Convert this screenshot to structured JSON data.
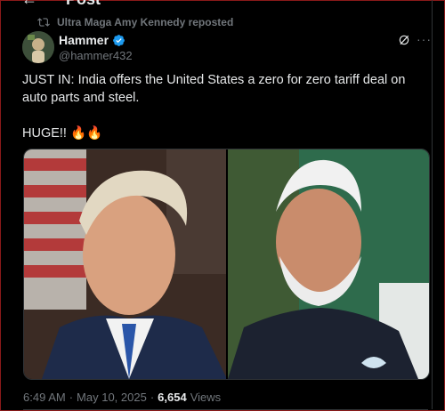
{
  "header": {
    "title": "Post"
  },
  "repost": {
    "text": "Ultra Maga Amy Kennedy reposted"
  },
  "author": {
    "name": "Hammer",
    "handle": "@hammer432"
  },
  "tweet": {
    "line1": "JUST IN: India offers the United States a zero for zero tariff deal on auto parts and steel.",
    "line2": "HUGE!! 🔥🔥"
  },
  "meta": {
    "time": "6:49 AM",
    "dot1": "·",
    "date": "May 10, 2025",
    "dot2": "·",
    "views_count": "6,654",
    "views_label": "Views"
  },
  "colors": {
    "background": "#000000",
    "text": "#e7e9ea",
    "muted": "#71767b",
    "verified": "#1d9bf0"
  },
  "icons": [
    "back-arrow-icon",
    "repost-icon",
    "verified-badge-icon",
    "grok-icon",
    "more-icon"
  ]
}
